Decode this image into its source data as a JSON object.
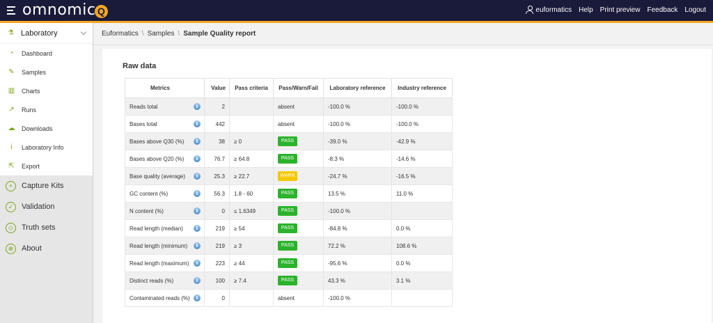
{
  "topbar": {
    "brand": "omnomics",
    "brand_mark": "Q",
    "user": "euformatics",
    "links": [
      "Help",
      "Print preview",
      "Feedback",
      "Logout"
    ]
  },
  "sidebar": {
    "section": "Laboratory",
    "items": [
      {
        "label": "Dashboard",
        "icon": "dashboard-icon",
        "glyph": "◔"
      },
      {
        "label": "Samples",
        "icon": "pencil-icon",
        "glyph": "✎"
      },
      {
        "label": "Charts",
        "icon": "bar-chart-icon",
        "glyph": "▥"
      },
      {
        "label": "Runs",
        "icon": "line-chart-icon",
        "glyph": "↗"
      },
      {
        "label": "Downloads",
        "icon": "cloud-download-icon",
        "glyph": "☁"
      },
      {
        "label": "Laboratory Info",
        "icon": "info-icon",
        "glyph": "i"
      },
      {
        "label": "Export",
        "icon": "export-icon",
        "glyph": "⇱"
      }
    ],
    "main": [
      {
        "label": "Capture Kits",
        "icon": "capture-kit-icon",
        "glyph": "+"
      },
      {
        "label": "Validation",
        "icon": "check-circle-icon",
        "glyph": "✓"
      },
      {
        "label": "Truth sets",
        "icon": "cube-icon",
        "glyph": "◇"
      },
      {
        "label": "About",
        "icon": "globe-icon",
        "glyph": "⊕"
      }
    ]
  },
  "breadcrumb": [
    "Euformatics",
    "Samples",
    "Sample Quality report"
  ],
  "section_title": "Raw data",
  "table": {
    "headers": [
      "Metrics",
      "Value",
      "Pass criteria",
      "Pass/Warn/Fail",
      "Laboratory reference",
      "Industry reference"
    ],
    "rows": [
      {
        "metric": "Reads total",
        "value": "2",
        "criteria": "",
        "status": "absent",
        "lab": "-100.0 %",
        "industry": "-100.0 %"
      },
      {
        "metric": "Bases total",
        "value": "442",
        "criteria": "",
        "status": "absent",
        "lab": "-100.0 %",
        "industry": "-100.0 %"
      },
      {
        "metric": "Bases above Q30 (%)",
        "value": "38",
        "criteria": "≥ 0",
        "status": "PASS",
        "lab": "-39.0 %",
        "industry": "-42.9 %"
      },
      {
        "metric": "Bases above Q20 (%)",
        "value": "76.7",
        "criteria": "≥ 64.8",
        "status": "PASS",
        "lab": "-8.3 %",
        "industry": "-14.6 %"
      },
      {
        "metric": "Base quality (average)",
        "value": "25.3",
        "criteria": "≥ 22.7",
        "status": "WARN",
        "lab": "-24.7 %",
        "industry": "-16.5 %"
      },
      {
        "metric": "GC content (%)",
        "value": "56.3",
        "criteria": "1.8 - 60",
        "status": "PASS",
        "lab": "13.5 %",
        "industry": "11.0 %"
      },
      {
        "metric": "N content (%)",
        "value": "0",
        "criteria": "≤ 1.6349",
        "status": "PASS",
        "lab": "-100.0 %",
        "industry": ""
      },
      {
        "metric": "Read length (median)",
        "value": "219",
        "criteria": "≥ 54",
        "status": "PASS",
        "lab": "-84.8 %",
        "industry": "0.0 %"
      },
      {
        "metric": "Read length (minimum)",
        "value": "219",
        "criteria": "≥ 3",
        "status": "PASS",
        "lab": "72.2 %",
        "industry": "108.6 %"
      },
      {
        "metric": "Read length (maximum)",
        "value": "223",
        "criteria": "≥ 44",
        "status": "PASS",
        "lab": "-95.6 %",
        "industry": "0.0 %"
      },
      {
        "metric": "Distinct reads (%)",
        "value": "100",
        "criteria": "≥ 7.4",
        "status": "PASS",
        "lab": "43.3 %",
        "industry": "3.1 %"
      },
      {
        "metric": "Contaminated reads (%)",
        "value": "0",
        "criteria": "",
        "status": "absent",
        "lab": "-100.0 %",
        "industry": ""
      }
    ]
  },
  "colors": {
    "topbar": "#1a1a3a",
    "accent": "#f5a623",
    "pass": "#2bb32b",
    "warn": "#f5c800",
    "sidebar_icon": "#7aa516"
  }
}
